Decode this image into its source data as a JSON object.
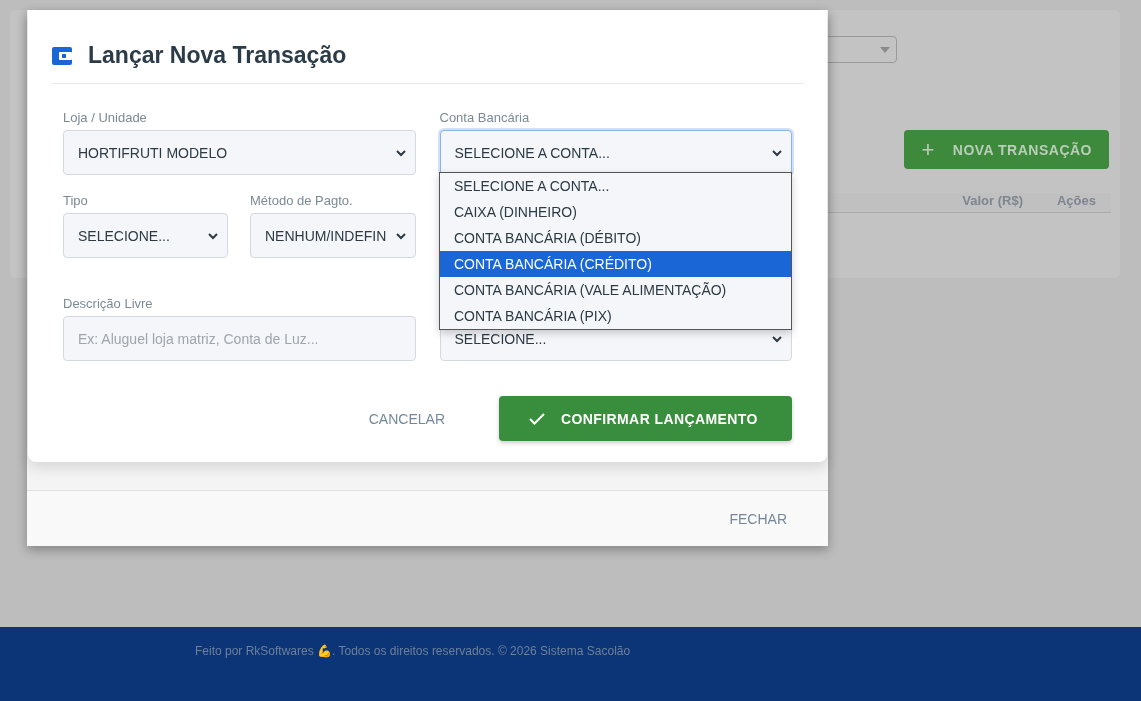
{
  "background": {
    "new_transaction_button": {
      "icon": "+",
      "label": "NOVA TRANSAÇÃO"
    },
    "table_columns": [
      "Valor (R$)",
      "Ações"
    ]
  },
  "footer": {
    "text": "Feito por RkSoftwares 💪. Todos os direitos reservados. © 2026 Sistema Sacolão"
  },
  "outer_modal": {
    "close_button": "FECHAR"
  },
  "dialog": {
    "title": "Lançar Nova Transação",
    "rows": [
      {
        "cells": [
          {
            "kind": "select",
            "label": "Loja / Unidade",
            "value": "HORTIFRUTI MODELO",
            "focused": false
          },
          {
            "kind": "select",
            "label": "Conta Bancária",
            "value": "SELECIONE A CONTA...",
            "focused": true
          }
        ]
      },
      {
        "cells": [
          {
            "kind": "pair",
            "fields": [
              {
                "kind": "select",
                "label": "Tipo",
                "value": "SELECIONE...",
                "focused": false
              },
              {
                "kind": "select",
                "label": "Método de Pagto.",
                "value": "NENHUM/INDEFIN",
                "focused": false
              }
            ]
          }
        ]
      },
      {
        "cells": [
          {
            "kind": "input",
            "label": "Descrição Livre",
            "placeholder": "Ex: Aluguel loja matriz, Conta de Luz..."
          },
          {
            "kind": "select",
            "value": "SELECIONE...",
            "focused": false
          }
        ]
      }
    ],
    "dropdown": {
      "options": [
        {
          "label": "SELECIONE A CONTA...",
          "selected": false
        },
        {
          "label": "CAIXA (DINHEIRO)",
          "selected": false
        },
        {
          "label": "CONTA BANCÁRIA (DÉBITO)",
          "selected": false
        },
        {
          "label": "CONTA BANCÁRIA (CRÉDITO)",
          "selected": true
        },
        {
          "label": "CONTA BANCÁRIA (VALE ALIMENTAÇÃO)",
          "selected": false
        },
        {
          "label": "CONTA BANCÁRIA (PIX)",
          "selected": false
        }
      ]
    },
    "cancel_button": "CANCELAR",
    "confirm_button": "CONFIRMAR LANÇAMENTO"
  }
}
